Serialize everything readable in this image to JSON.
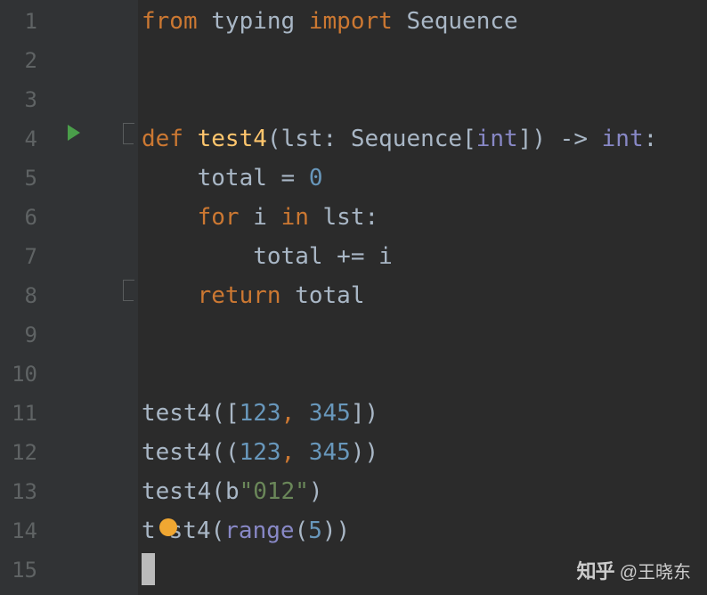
{
  "lines": {
    "count": 15,
    "numbers": [
      "1",
      "2",
      "3",
      "4",
      "5",
      "6",
      "7",
      "8",
      "9",
      "10",
      "11",
      "12",
      "13",
      "14",
      "15"
    ]
  },
  "code": {
    "l1": {
      "from": "from",
      "typing": "typing",
      "import": "import",
      "seq": "Sequence"
    },
    "l4": {
      "def": "def",
      "fn": "test4",
      "lp": "(",
      "p": "lst",
      "colon": ":",
      "sp": " ",
      "seq": "Sequence",
      "lb": "[",
      "int": "int",
      "rb": "]",
      "rp": ")",
      "arr": " -> ",
      "ret": "int",
      "end": ":"
    },
    "l5": {
      "indent": "    ",
      "var": "total",
      "eq": " = ",
      "val": "0"
    },
    "l6": {
      "indent": "    ",
      "for": "for",
      "i": " i ",
      "in": "in",
      "lst": " lst",
      "colon": ":"
    },
    "l7": {
      "indent": "        ",
      "var": "total",
      "op": " += ",
      "i": "i"
    },
    "l8": {
      "indent": "    ",
      "ret": "return",
      "val": " total"
    },
    "l11": {
      "fn": "test4",
      "lp": "(",
      "lb": "[",
      "n1": "123",
      "c": ",",
      "sp": " ",
      "n2": "345",
      "rb": "]",
      "rp": ")"
    },
    "l12": {
      "fn": "test4",
      "lp": "(",
      "lb": "(",
      "n1": "123",
      "c": ",",
      "sp": " ",
      "n2": "345",
      "rb": ")",
      "rp": ")"
    },
    "l13": {
      "fn": "test4",
      "lp": "(",
      "b": "b",
      "str": "\"012\"",
      "rp": ")"
    },
    "l14": {
      "t": "t",
      "st4": "st4",
      "lp": "(",
      "range": "range",
      "lp2": "(",
      "n": "5",
      "rp2": ")",
      "rp": ")"
    }
  },
  "watermark": {
    "logo": "知乎",
    "at": "@王晓东"
  }
}
